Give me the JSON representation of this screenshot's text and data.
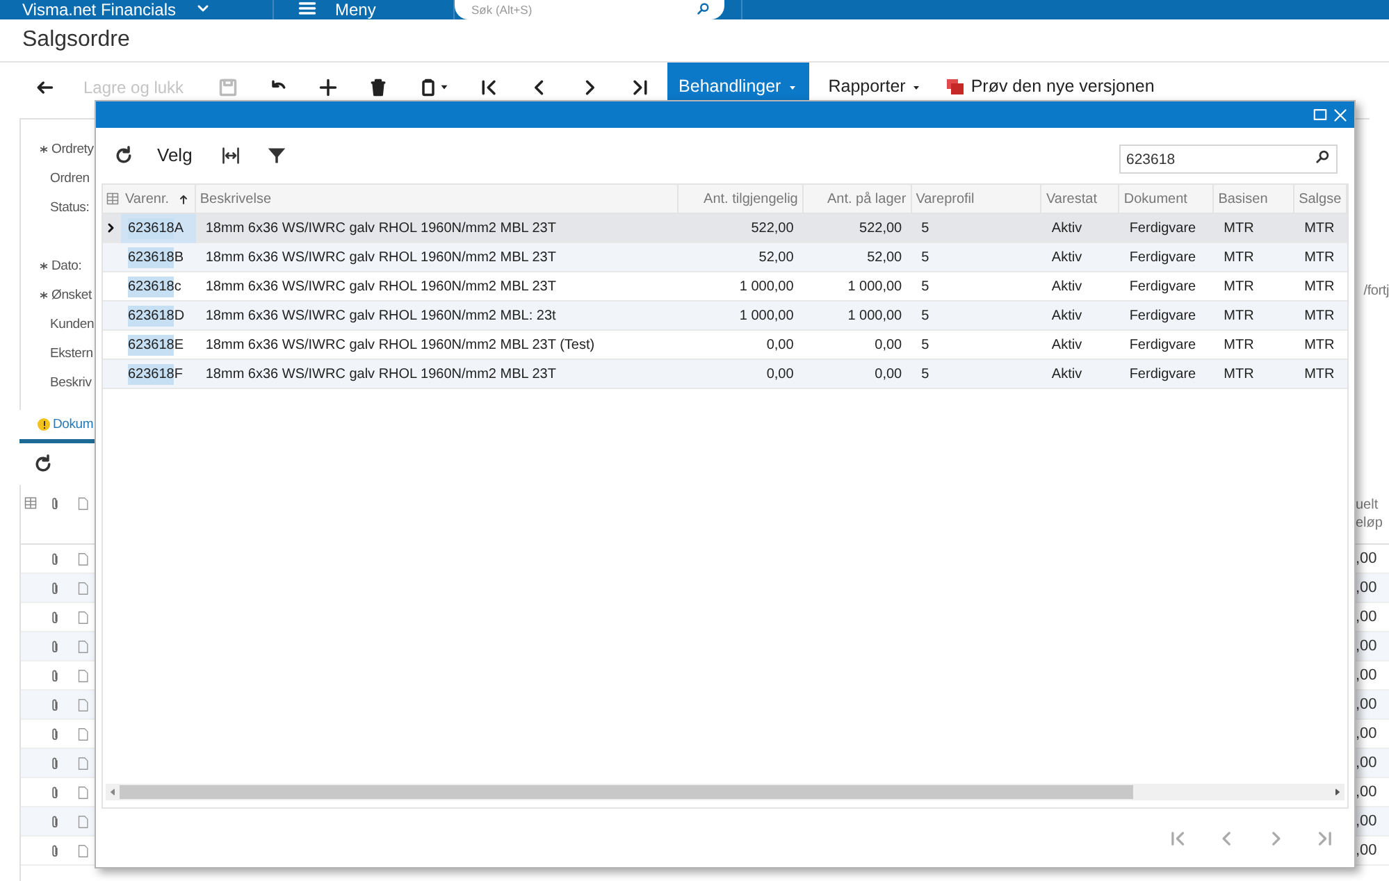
{
  "top_bar": {
    "app_name": "Visma.net Financials",
    "menu": "Meny",
    "search": {
      "placeholder": "Søk (Alt+S)"
    }
  },
  "page_title": "Salgsordre",
  "toolbar": {
    "save_close": {
      "label": "Lagre og lukk",
      "disabled": true
    },
    "menus": [
      {
        "label": "Behandlinger",
        "selected": true
      },
      {
        "label": "Rapporter",
        "selected": false
      }
    ],
    "try_new": "Prøv den nye versjonen"
  },
  "form_labels": [
    {
      "label": "Ordrety",
      "required": true
    },
    {
      "label": "Ordren",
      "required": false
    },
    {
      "label": "Status:",
      "required": false
    },
    {
      "label": "Dato:",
      "required": true
    },
    {
      "label": "Ønsket",
      "required": true
    },
    {
      "label": "Kunden",
      "required": false
    },
    {
      "label": "Ekstern",
      "required": false
    },
    {
      "label": "Beskriv",
      "required": false
    }
  ],
  "form_right_text": "/fortj",
  "tab": {
    "label": "Dokum",
    "warning": true
  },
  "background_grid": {
    "header": [
      "uelt",
      "eløp"
    ],
    "rows": [
      ",00",
      ",00",
      ",00",
      ",00",
      ",00",
      ",00",
      ",00",
      ",00",
      ",00",
      ",00",
      ",00"
    ]
  },
  "dialog": {
    "toolbar": {
      "select": "Velg"
    },
    "search": {
      "value": "623618"
    },
    "columns": [
      {
        "label": "Varenr.",
        "sorted": true
      },
      {
        "label": "Beskrivelse",
        "sorted": false
      },
      {
        "label": "Ant. tilgjengelig",
        "sorted": false
      },
      {
        "label": "Ant. på lager",
        "sorted": false
      },
      {
        "label": "Vareprofil",
        "sorted": false
      },
      {
        "label": "Varestat",
        "sorted": false
      },
      {
        "label": "Dokument",
        "sorted": false
      },
      {
        "label": "Basisen",
        "sorted": false
      },
      {
        "label": "Salgse",
        "sorted": false
      }
    ],
    "rows": [
      {
        "selected": true,
        "cells": [
          {
            "match": "623618",
            "rest": "A"
          },
          "18mm 6x36 WS/IWRC galv RHOL 1960N/mm2 MBL 23T",
          "522,00",
          "522,00",
          "5",
          "Aktiv",
          "Ferdigvare",
          "MTR",
          "MTR"
        ]
      },
      {
        "selected": false,
        "cells": [
          {
            "match": "623618",
            "rest": "B"
          },
          "18mm 6x36 WS/IWRC galv RHOL 1960N/mm2 MBL 23T",
          "52,00",
          "52,00",
          "5",
          "Aktiv",
          "Ferdigvare",
          "MTR",
          "MTR"
        ]
      },
      {
        "selected": false,
        "cells": [
          {
            "match": "623618",
            "rest": "c"
          },
          "18mm 6x36 WS/IWRC galv RHOL 1960N/mm2 MBL 23T",
          "1 000,00",
          "1 000,00",
          "5",
          "Aktiv",
          "Ferdigvare",
          "MTR",
          "MTR"
        ]
      },
      {
        "selected": false,
        "cells": [
          {
            "match": "623618",
            "rest": "D"
          },
          "18mm 6x36 WS/IWRC galv RHOL 1960N/mm2 MBL: 23t",
          "1 000,00",
          "1 000,00",
          "5",
          "Aktiv",
          "Ferdigvare",
          "MTR",
          "MTR"
        ]
      },
      {
        "selected": false,
        "cells": [
          {
            "match": "623618",
            "rest": "E"
          },
          "18mm 6x36 WS/IWRC galv RHOL 1960N/mm2 MBL 23T (Test)",
          "0,00",
          "0,00",
          "5",
          "Aktiv",
          "Ferdigvare",
          "MTR",
          "MTR"
        ]
      },
      {
        "selected": false,
        "cells": [
          {
            "match": "623618",
            "rest": "F"
          },
          "18mm 6x36 WS/IWRC galv RHOL 1960N/mm2 MBL 23T",
          "0,00",
          "0,00",
          "5",
          "Aktiv",
          "Ferdigvare",
          "MTR",
          "MTR"
        ]
      }
    ]
  }
}
